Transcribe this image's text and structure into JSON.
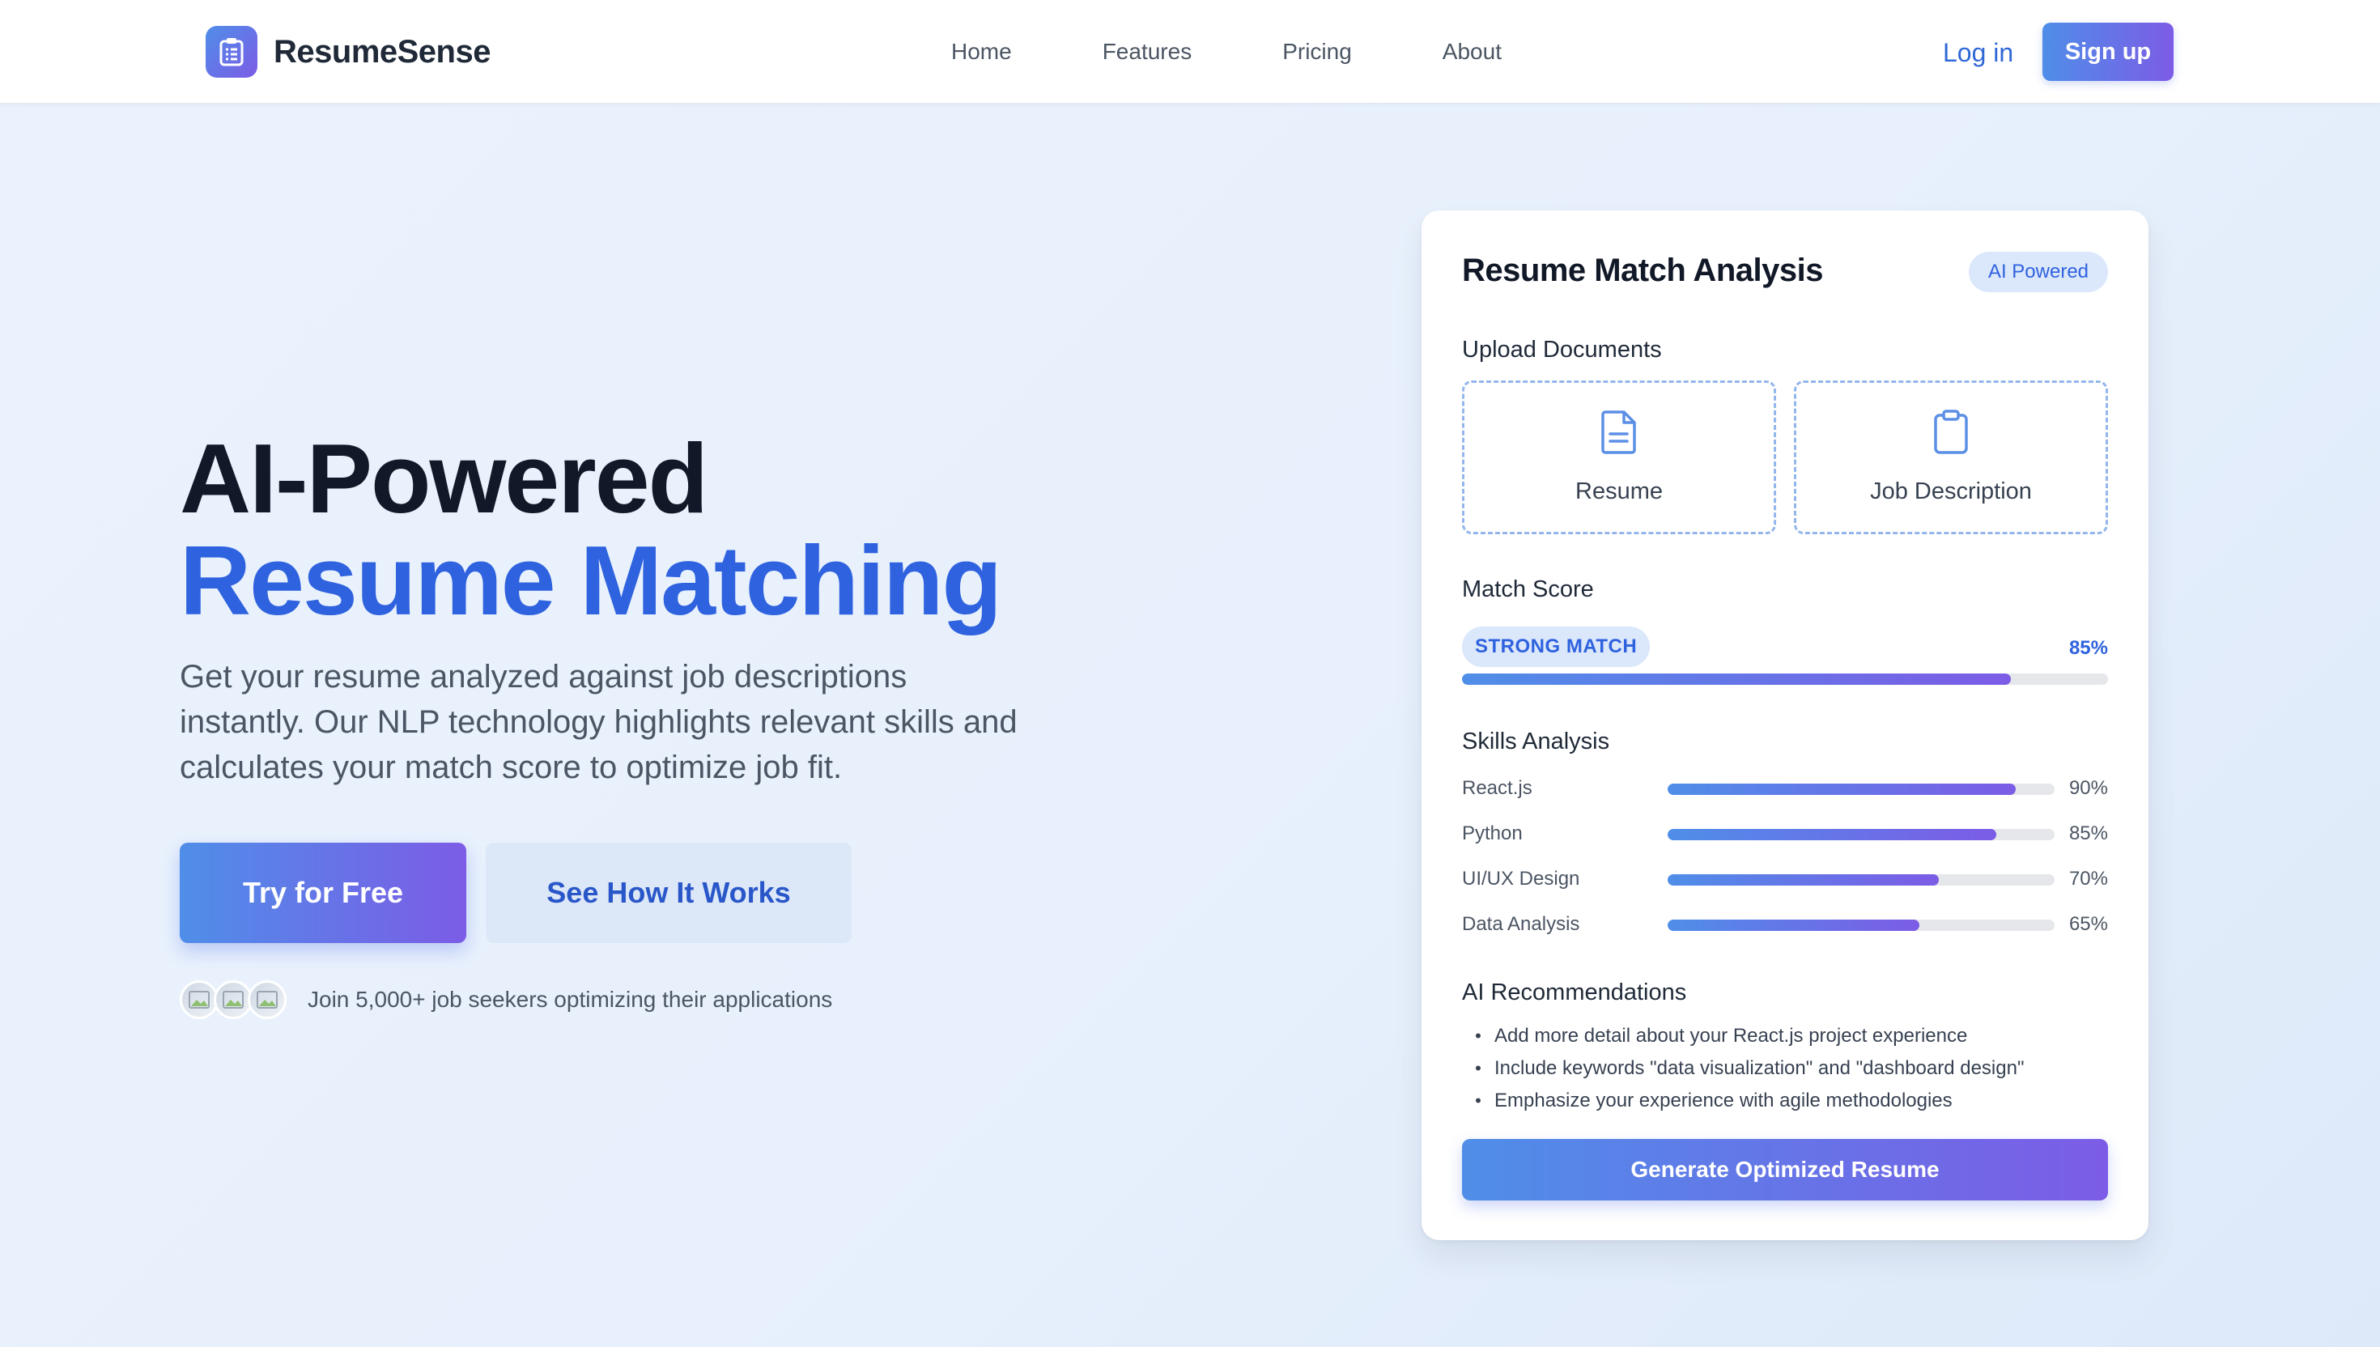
{
  "brand": {
    "name": "ResumeSense",
    "icon": "clipboard-list-icon"
  },
  "nav": {
    "links": [
      "Home",
      "Features",
      "Pricing",
      "About"
    ],
    "login": "Log in",
    "signup": "Sign up"
  },
  "hero": {
    "title_line1": "AI-Powered",
    "title_line2": "Resume Matching",
    "description": "Get your resume analyzed against job descriptions instantly. Our NLP technology highlights relevant skills and calculates your match score to optimize job fit.",
    "primary_cta": "Try for Free",
    "secondary_cta": "See How It Works",
    "social_proof": "Join 5,000+ job seekers optimizing their applications"
  },
  "card": {
    "title": "Resume Match Analysis",
    "badge": "AI Powered",
    "upload": {
      "label": "Upload Documents",
      "items": [
        {
          "label": "Resume",
          "icon": "document-icon"
        },
        {
          "label": "Job Description",
          "icon": "clipboard-icon"
        }
      ]
    },
    "match": {
      "label": "Match Score",
      "status": "STRONG MATCH",
      "percent_text": "85%",
      "value": 0.85
    },
    "skills": {
      "label": "Skills Analysis",
      "items": [
        {
          "name": "React.js",
          "percent_text": "90%",
          "value": 0.9
        },
        {
          "name": "Python",
          "percent_text": "85%",
          "value": 0.85
        },
        {
          "name": "UI/UX Design",
          "percent_text": "70%",
          "value": 0.7
        },
        {
          "name": "Data Analysis",
          "percent_text": "65%",
          "value": 0.65
        }
      ]
    },
    "recommendations": {
      "label": "AI Recommendations",
      "items": [
        "Add more detail about your React.js project experience",
        "Include keywords \"data visualization\" and \"dashboard design\"",
        "Emphasize your experience with agile methodologies"
      ]
    },
    "generate_button": "Generate Optimized Resume"
  },
  "colors": {
    "accent_blue": "#2f62df",
    "gradient_start": "#4f8ee8",
    "gradient_end": "#7c5ce6"
  }
}
